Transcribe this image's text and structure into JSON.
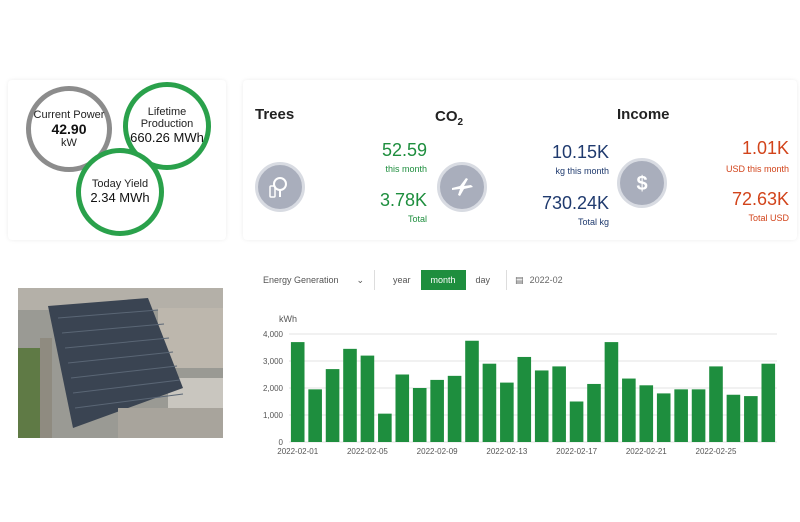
{
  "power": {
    "current": {
      "label": "Current Power",
      "value": "42.90",
      "unit": "kW"
    },
    "lifetime": {
      "label_line1": "Lifetime",
      "label_line2": "Production",
      "value": "660.26 MWh"
    },
    "today": {
      "label": "Today Yield",
      "value": "2.34 MWh"
    }
  },
  "stats": {
    "trees": {
      "title": "Trees",
      "month_value": "52.59",
      "month_label": "this month",
      "total_value": "3.78K",
      "total_label": "Total",
      "icon": "tree-icon"
    },
    "co2": {
      "title": "CO",
      "subscript": "2",
      "month_value": "10.15K",
      "month_label": "kg this month",
      "total_value": "730.24K",
      "total_label": "Total kg",
      "icon": "airplane-icon"
    },
    "income": {
      "title": "Income",
      "month_value": "1.01K",
      "month_label": "USD this month",
      "total_value": "72.63K",
      "total_label": "Total USD",
      "icon": "dollar-icon"
    }
  },
  "colors": {
    "green": "#1e8e3e",
    "navy": "#1f3a6e",
    "orange": "#d2441b",
    "ring_gray": "#8c8c8c"
  },
  "chart_controls": {
    "metric": "Energy Generation",
    "periods": [
      "year",
      "month",
      "day"
    ],
    "active_period": "month",
    "date": "2022-02"
  },
  "chart_data": {
    "type": "bar",
    "ylabel": "kWh",
    "ylim": [
      0,
      4000
    ],
    "yticks": [
      "0",
      "1,000",
      "2,000",
      "3,000",
      "4,000"
    ],
    "xtick_labels": [
      "2022-02-01",
      "2022-02-05",
      "2022-02-09",
      "2022-02-13",
      "2022-02-17",
      "2022-02-21",
      "2022-02-25"
    ],
    "categories": [
      "2022-02-01",
      "2022-02-02",
      "2022-02-03",
      "2022-02-04",
      "2022-02-05",
      "2022-02-06",
      "2022-02-07",
      "2022-02-08",
      "2022-02-09",
      "2022-02-10",
      "2022-02-11",
      "2022-02-12",
      "2022-02-13",
      "2022-02-14",
      "2022-02-15",
      "2022-02-16",
      "2022-02-17",
      "2022-02-18",
      "2022-02-19",
      "2022-02-20",
      "2022-02-21",
      "2022-02-22",
      "2022-02-23",
      "2022-02-24",
      "2022-02-25",
      "2022-02-26",
      "2022-02-27",
      "2022-02-28"
    ],
    "values": [
      3700,
      1950,
      2700,
      3450,
      3200,
      1050,
      2500,
      2000,
      2300,
      2450,
      3750,
      2900,
      2200,
      3150,
      2650,
      2800,
      1500,
      2150,
      3700,
      2350,
      2100,
      1800,
      1950,
      1950,
      2800,
      1750,
      1700,
      2900
    ],
    "bar_color": "#1e8e3e",
    "grid": true
  }
}
